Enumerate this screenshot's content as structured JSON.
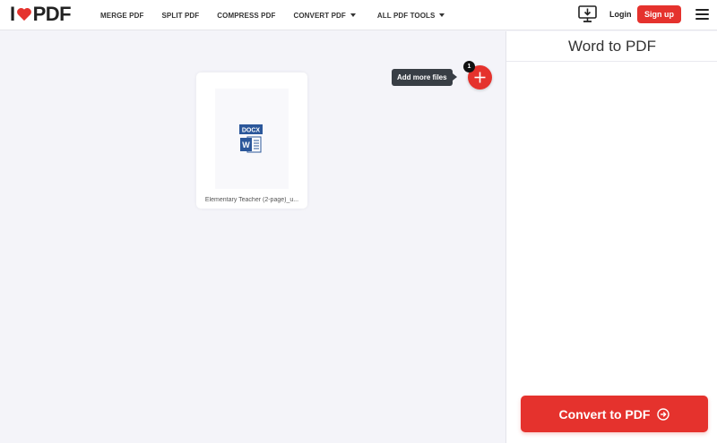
{
  "header": {
    "logo_i": "I",
    "logo_pdf": "PDF",
    "nav": [
      {
        "label": "MERGE PDF"
      },
      {
        "label": "SPLIT PDF"
      },
      {
        "label": "COMPRESS PDF"
      },
      {
        "label": "CONVERT PDF"
      },
      {
        "label": "ALL PDF TOOLS"
      }
    ],
    "login_label": "Login",
    "signup_label": "Sign up"
  },
  "workspace": {
    "tooltip": "Add more files",
    "file_count": "1",
    "file": {
      "type_badge": "DOCX",
      "word_letter": "W",
      "name": "Elementary Teacher (2-page)_u..."
    }
  },
  "sidebar": {
    "title": "Word to PDF",
    "convert_label": "Convert to PDF"
  },
  "colors": {
    "accent": "#e5322d",
    "word_blue": "#2b579a",
    "tooltip_bg": "#383e45"
  },
  "icons": {
    "logo": "heart-icon",
    "desktop": "desktop-download-icon",
    "menu": "hamburger-menu-icon",
    "add": "plus-icon",
    "file": "docx-file-icon",
    "convert": "arrow-right-circle-icon"
  }
}
